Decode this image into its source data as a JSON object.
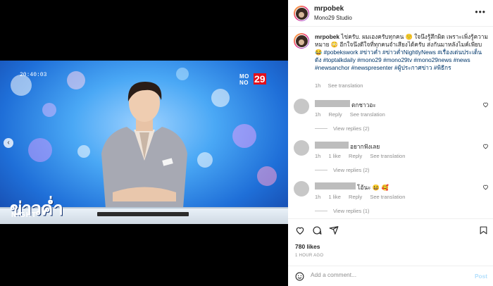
{
  "media": {
    "clock": "20:40:03",
    "channel_logo_top": "MO\nNO",
    "channel_logo_num": "29",
    "show_title": "ข่าวค่ำ",
    "show_subtitle": "NIGHT",
    "prev_glyph": "‹"
  },
  "header": {
    "username": "mrpobek",
    "location": "Mono29 Studio",
    "more_glyph": "•••"
  },
  "caption": {
    "username": "mrpobek",
    "text": "ไข่ครับ. ผมเองครับทุกคน 🙂 ใจนึงรู้สึกผิด เพราะเพิ่งรู้ความหมาย 😳 อีกใจนึงดีใจที่ทุกคนจำเสียงได้ครับ ส่งกันมาหลังไมค์เพียบ 😂",
    "tags": "#pobekswork #ข่าวค่ำ #ข่าวค่ำNightlyNews #เรื่องเด่นประเด็นดัง #toptalkdaily #mono29 #mono29tv #mono29news #news #newsanchor #newspresenter #ผู้ประกาศข่าว #พิธีกร",
    "time": "1h",
    "see_translation": "See translation"
  },
  "comments": [
    {
      "text": "ตกชาวอะ",
      "time": "1h",
      "reply": "Reply",
      "see_translation": "See translation",
      "view_replies": "View replies (2)"
    },
    {
      "text": "อยากฟังเลย",
      "time": "1h",
      "likes": "1 like",
      "reply": "Reply",
      "see_translation": "See translation",
      "view_replies": "View replies (2)"
    },
    {
      "text": "โอ้นะ 😆 🥰",
      "time": "1h",
      "likes": "1 like",
      "reply": "Reply",
      "see_translation": "See translation",
      "view_replies": "View replies (1)"
    }
  ],
  "icons": {
    "heart": "heart-icon",
    "comment": "comment-icon",
    "share": "share-icon",
    "save": "bookmark-icon",
    "emoji": "emoji-icon"
  },
  "stats": {
    "likes": "780 likes",
    "time": "1 HOUR AGO"
  },
  "add_comment": {
    "placeholder": "Add a comment...",
    "post": "Post"
  },
  "colors": {
    "link": "#00376b",
    "secondary": "#8e8e8e",
    "post_disabled": "#b2dffc"
  }
}
